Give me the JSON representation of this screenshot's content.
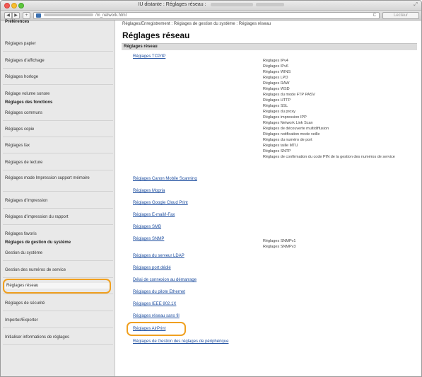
{
  "window": {
    "title": "IU distante : Réglages réseau :",
    "url": "/m_network.html",
    "reader_label": "Lecteur"
  },
  "sidebar": {
    "sections": [
      {
        "heading": "Préférences",
        "items": [
          "Réglages papier",
          "Réglages d'affichage",
          "Réglages horloge",
          "Réglage volume sonore"
        ]
      },
      {
        "heading": "Réglages des fonctions",
        "items": [
          "Réglages communs",
          "Réglages copie",
          "Réglages fax",
          "Réglages de lecture",
          "Réglages mode Impression support mémoire",
          "Réglages d'impression",
          "Réglages d'impression du rapport",
          "Réglages favoris"
        ]
      },
      {
        "heading": "Réglages de gestion du système",
        "items": [
          "Gestion du système",
          "Gestion des numéros de service",
          "Réglages réseau",
          "Réglages de sécurité",
          "Importer/Exporter",
          "Initialiser informations de réglages"
        ]
      }
    ]
  },
  "main": {
    "breadcrumb": "Réglages/Enregistrement : Réglages de gestion du système : Réglages réseau",
    "title": "Réglages réseau",
    "section_header": "Réglages réseau",
    "tcpip": {
      "label": "Réglages TCP/IP",
      "subitems": [
        "Réglages IPv4",
        "Réglages IPv6",
        "Réglages WINS",
        "Réglages LPD",
        "Réglages RAW",
        "Réglages WSD",
        "Réglages du mode FTP PASV",
        "Réglages HTTP",
        "Réglages SSL",
        "Réglages du proxy",
        "Réglages impression IPP",
        "Réglages Network Link Scan",
        "Réglages de découverte multidiffusion",
        "Réglages notification mode veille",
        "Réglages du numéro de port",
        "Réglages taille MTU",
        "Réglages SNTP",
        "Réglages de confirmation du code PIN de la gestion des numéros de service"
      ]
    },
    "links_group1": [
      "Réglages Canon Mobile Scanning",
      "Réglages Mopria",
      "Réglages Google Cloud Print",
      "Réglages E-mail/I-Fax",
      "Réglages SMB"
    ],
    "snmp": {
      "label": "Réglages SNMP",
      "subitems": [
        "Réglages SNMPv1",
        "Réglages SNMPv3"
      ]
    },
    "links_group2": [
      "Réglages du serveur LDAP",
      "Réglages port dédié",
      "Délai de connexion au démarrage",
      "Réglages du pilote Ethernet",
      "Réglages IEEE 802.1X",
      "Réglages réseau sans fil",
      "Réglages AirPrint",
      "Réglages de Gestion des réglages de périphérique"
    ]
  }
}
